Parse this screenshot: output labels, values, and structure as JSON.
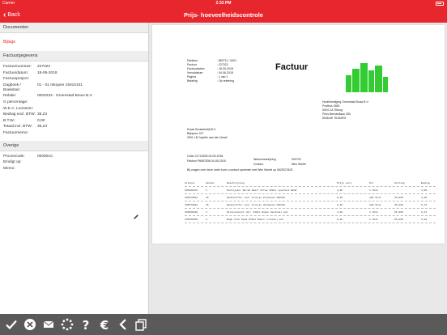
{
  "statusbar": {
    "carrier": "Carrier",
    "time": "2:33 PM"
  },
  "navbar": {
    "back_label": "Back",
    "title": "Prijs- hoeveelheidscontrole"
  },
  "sidebar": {
    "documenten": {
      "header": "Documenten",
      "link": "Bijlage"
    },
    "factuurgegevens": {
      "header": "Factuurgegevens",
      "rows": [
        {
          "label": "Factuurnummer:",
          "value": "227022"
        },
        {
          "label": "Factuurdatum:",
          "value": "18-05-2018"
        },
        {
          "label": "Factuurproject:",
          "value": ""
        },
        {
          "label": "Dagboek / Boekstuk:",
          "value": "01 - 01 Inkopen 15010101"
        },
        {
          "label": "Relatie:",
          "value": "0000233 - Groenstad Bouw B.V."
        },
        {
          "label": "G percentage:",
          "value": ""
        },
        {
          "label": "W.K.A. Loonsom:",
          "value": ""
        },
        {
          "label": "Bedrag excl. BTW:",
          "value": "35,23"
        },
        {
          "label": "B.T.W.:",
          "value": "0,00"
        },
        {
          "label": "Totaal incl. BTW:",
          "value": "35,23"
        },
        {
          "label": "Factuurmemo:",
          "value": ""
        }
      ]
    },
    "overige": {
      "header": "Overige",
      "rows": [
        {
          "label": "Procescode:",
          "value": "000001C"
        },
        {
          "label": "Eindigt op:",
          "value": ""
        },
        {
          "label": "Memo:",
          "value": ""
        }
      ]
    }
  },
  "invoice": {
    "meta": [
      {
        "k": "Debiteur",
        "v": ": 882711 / 0001"
      },
      {
        "k": "Factuur",
        "v": ": 227022"
      },
      {
        "k": "Factuurdatum",
        "v": ": 18-05-2018"
      },
      {
        "k": "Vervaldatum",
        "v": ": 04-06-2018"
      },
      {
        "k": "Pagina",
        "v": ": 1 van 1"
      },
      {
        "k": "Betaling",
        "v": ": Op rekening"
      }
    ],
    "title": "Factuur",
    "sender": [
      "Hoofdvestiging Groenstad Bouw B.V.",
      "Postbus 3484",
      "5004 CA Tilburg",
      "Prins Bernardlaan 283",
      "5048 AK TILBURG"
    ],
    "recipient": [
      "Kraan Bouwbedrijf B.V.",
      "Blijnpoor 227",
      "2901 LB Capelle aan den IJssel"
    ],
    "order_line1": "Order       21722525  03-05-2018",
    "order_line2": "Pakbon      P6657836  04-05-2018",
    "werkomschrijving_label": "Werkomschrijving",
    "werkomschrijving_value": "393702",
    "contact_label": "Contact",
    "contact_value": "Wim Wortel",
    "vragen": "Bij vragen over deze order kunt u contact opnemen met Wim Wortel op 0625372622",
    "table_headers": [
      "Artikel",
      "Aantal",
      "Omschrijving",
      "Prijs excl.",
      "Per",
      "Korting",
      "Bedrag"
    ],
    "table_rows": [
      [
        "105209478",
        "1",
        "Multijoker WD-40 Smart Straw 450ml spuitbus WD4F",
        "4,95",
        "1 Stuk",
        "",
        "4,95"
      ],
      [
        "105578681",
        "15",
        "Wandschrfer voor kruisje Polybouw 100x50",
        "0,45",
        "100 Stuk",
        "35,00%",
        "4,39"
      ],
      [
        "105578681",
        "15",
        "Wandschrfer voor kruisje Hardwood 100x50",
        "6,45",
        "100 Stuk",
        "35,00%",
        "5,13"
      ],
      [
        "105969838",
        "4",
        "Siliconenkit (W): 310ml Ruben Sanitair wit",
        "4,48",
        "1 Stuk",
        "65,00%",
        "6,27"
      ],
      [
        "105250358",
        "4",
        "Bugh Tech Kiwa 670ml Ruben (ruimte) wit",
        "8,49",
        "1 Stuk",
        "65,00%",
        "5,94"
      ]
    ]
  },
  "colors": {
    "brand_red": "#e8262d",
    "logo_green": "#33cc33",
    "toolbar_gray": "#5a5a5a"
  },
  "toolbar": {
    "icons": [
      "check-icon",
      "cancel-icon",
      "mail-icon",
      "loading-icon",
      "help-icon",
      "euro-icon",
      "back-icon",
      "copy-icon"
    ]
  }
}
